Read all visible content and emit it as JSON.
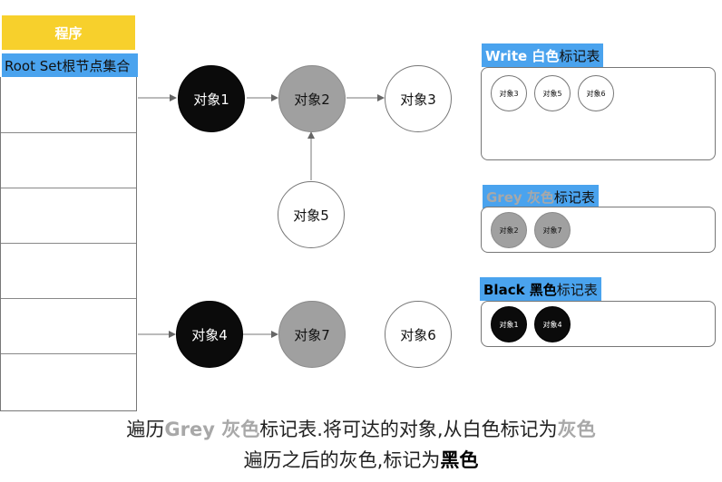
{
  "program": {
    "label": "程序"
  },
  "root_set": {
    "label": "Root Set根节点集合"
  },
  "nodes": {
    "obj1": "对象1",
    "obj2": "对象2",
    "obj3": "对象3",
    "obj4": "对象4",
    "obj5": "对象5",
    "obj6": "对象6",
    "obj7": "对象7"
  },
  "tables": {
    "white": {
      "title_bold": "Write 白色",
      "title_rest": "标记表",
      "items": [
        "对象3",
        "对象5",
        "对象6"
      ]
    },
    "grey": {
      "title_bold": "Grey 灰色",
      "title_rest": "标记表",
      "items": [
        "对象2",
        "对象7"
      ]
    },
    "black": {
      "title_bold": "Black 黑色",
      "title_rest": "标记表",
      "items": [
        "对象1",
        "对象4"
      ]
    }
  },
  "caption": {
    "line1_a": "遍历",
    "line1_b": "Grey 灰色",
    "line1_c": "标记表.将可达的对象,从白色标记为",
    "line1_d": "灰色",
    "line2_a": "遍历之后的灰色,标记为",
    "line2_b": "黑色"
  },
  "colors": {
    "program_yellow": "#f7d02c",
    "label_blue": "#4aa3ee",
    "grey_node": "#a0a0a0",
    "black_node": "#0b0b0b"
  }
}
